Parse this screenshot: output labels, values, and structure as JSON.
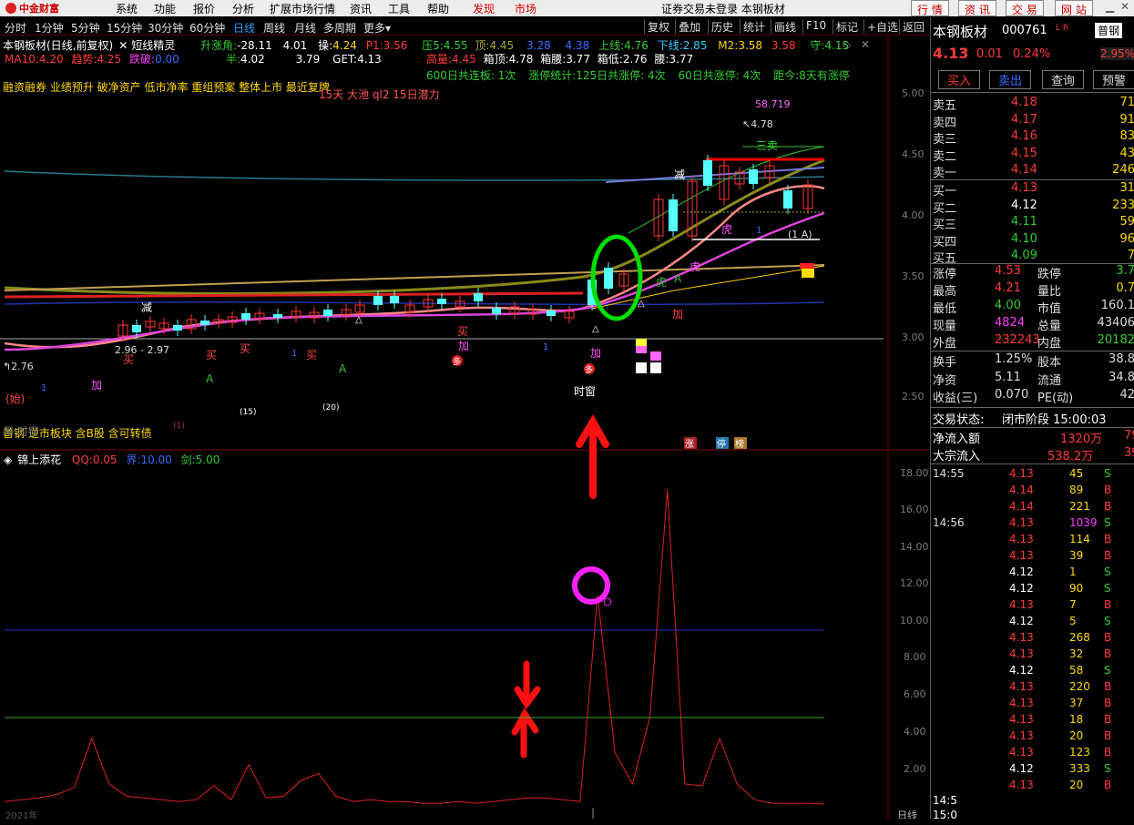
{
  "menu": {
    "items": [
      "系统",
      "功能",
      "报价",
      "分析",
      "扩展市场行情",
      "资讯",
      "工具",
      "帮助"
    ],
    "discover": "发现",
    "market": "市场",
    "center": "证券交易未登录  本钢板材",
    "right_buttons": [
      "行 情",
      "资 讯",
      "交 易",
      "网 站"
    ]
  },
  "toolbar": {
    "periods": [
      "分时",
      "1分钟",
      "5分钟",
      "15分钟",
      "30分钟",
      "60分钟",
      "日线",
      "周线",
      "月线",
      "多周期",
      "更多"
    ],
    "active": "日线",
    "right": [
      "复权",
      "叠加",
      "历史",
      "统计",
      "画线",
      "F10",
      "标记",
      "+自选",
      "返回"
    ]
  },
  "chart": {
    "title": "本钢板材(日线,前复权)",
    "formula": "短线精灵",
    "info": {
      "zhangjiao_lbl": "升涨角:",
      "zhangjiao": "-28.11",
      "v401": "4.01",
      "cao_lbl": "操:",
      "cao": "4.24",
      "p1_lbl": "P1:",
      "p1": "3.56",
      "ya5_lbl": "压5:",
      "ya5": "4.55",
      "ding_lbl": "顶:",
      "ding": "4.45",
      "v328": "3.28",
      "v438": "4.38",
      "shang_lbl": "上线:",
      "shang": "4.76",
      "xia_lbl": "下线:",
      "xia": "2.85",
      "m2_lbl": "M2:",
      "m2": "3.58",
      "m2b": "3.58",
      "shou_lbl": "守:",
      "shou": "4.15"
    },
    "info2": {
      "ban_lbl": "半:",
      "ban": "4.02",
      "get_lbl": "GET:",
      "get": "4.13",
      "v379": "3.79"
    },
    "info3": {
      "gaoliang_lbl": "高量:",
      "gaoliang": "4.45",
      "xiangding_lbl": "箱顶:",
      "xiangding": "4.78",
      "xiangyao_lbl": "箱腰:",
      "xiangyao": "3.77",
      "xiangdi_lbl": "箱低:",
      "xiangdi": "2.76",
      "yao_lbl": "腰:",
      "yao": "3.77"
    },
    "info4": {
      "lianban": "600日共连板: 1次",
      "zhangting": "涨停统计:125日共涨停: 4次",
      "zt600": "60日共涨停: 4次",
      "distance": "距今:8天有涨停"
    },
    "ma": {
      "ma10_lbl": "MA10:",
      "ma10": "4.20",
      "trend_lbl": "趋势:",
      "trend": "4.25",
      "die_lbl": "跌破:",
      "die": "0.00"
    },
    "tags": "融资融券 业绩预升 破净资产 低市净率 重组预案 整体上市 最近复牌",
    "tags2": "15天 大池 ql2 15日潜力",
    "peak": "58.719",
    "high": "4.78",
    "low_lbl": "2.76",
    "range": "2.96 - 2.97",
    "sanmai": "三卖",
    "ia": "(1 A)",
    "ylabels": [
      "5.00",
      "4.50",
      "4.00",
      "3.50",
      "3.00",
      "2.50"
    ],
    "signals": [
      "买",
      "买",
      "买",
      "买",
      "买",
      "加",
      "加",
      "加",
      "减",
      "减",
      "虎",
      "虎",
      "多",
      "多",
      "时窗",
      "(始)"
    ],
    "bottom_text": "普钢 逆市板块 含B股 含可转债",
    "bottom_text2": "用    时窗",
    "badges": [
      "涨",
      "停",
      "榜"
    ],
    "cnt": [
      "(15)",
      "(20)",
      "(1)"
    ]
  },
  "indicator": {
    "name": "锦上添花",
    "qq_lbl": "QQ:",
    "qq": "0.05",
    "jie_lbl": "界:",
    "jie": "10.00",
    "jian_lbl": "剑:",
    "jian": "5.00",
    "ylabels": [
      "18.00",
      "16.00",
      "14.00",
      "12.00",
      "10.00",
      "8.00",
      "6.00",
      "4.00",
      "2.00"
    ],
    "date": "2021年",
    "xlabel": "日线"
  },
  "chart_data": {
    "type": "line",
    "title": "锦上添花",
    "ylim": [
      0,
      19
    ],
    "series": [
      {
        "name": "QQ",
        "values": [
          0.2,
          0.3,
          0.4,
          0.6,
          1,
          3.8,
          1.2,
          0.5,
          0.4,
          0.3,
          0.2,
          0.3,
          1.1,
          0.3,
          2.3,
          0.4,
          0.5,
          1.4,
          1.8,
          0.5,
          0.2,
          0.3,
          0.2,
          0.2,
          0.1,
          0.1,
          0.2,
          0.1,
          0.2,
          0.3,
          0.4,
          0.4,
          0.3,
          0.2,
          12,
          3,
          1.2,
          5,
          18,
          1.2,
          1.1,
          3.8,
          1.2,
          0.3,
          0.1,
          0.1,
          0.1,
          0.05
        ]
      },
      {
        "name": "界",
        "values": [
          10
        ]
      },
      {
        "name": "剑",
        "values": [
          5
        ]
      }
    ]
  },
  "panel": {
    "name": "本钢板材",
    "code": "000761",
    "lr": "L R",
    "sector": "普钢",
    "price": "4.13",
    "change": "0.01",
    "pct": "0.24%",
    "pct2": "2.95%",
    "btn": [
      "买入",
      "卖出",
      "查询",
      "预警"
    ],
    "asks": [
      {
        "l": "卖五",
        "p": "4.18",
        "v": "71"
      },
      {
        "l": "卖四",
        "p": "4.17",
        "v": "91"
      },
      {
        "l": "卖三",
        "p": "4.16",
        "v": "83"
      },
      {
        "l": "卖二",
        "p": "4.15",
        "v": "43"
      },
      {
        "l": "卖一",
        "p": "4.14",
        "v": "246"
      }
    ],
    "bids": [
      {
        "l": "买一",
        "p": "4.13",
        "v": "31"
      },
      {
        "l": "买二",
        "p": "4.12",
        "v": "233"
      },
      {
        "l": "买三",
        "p": "4.11",
        "v": "59"
      },
      {
        "l": "买四",
        "p": "4.10",
        "v": "96"
      },
      {
        "l": "买五",
        "p": "4.09",
        "v": "7"
      }
    ],
    "stats": [
      {
        "a": "涨停",
        "av": "4.53",
        "b": "跌停",
        "bv": "3.7"
      },
      {
        "a": "最高",
        "av": "4.21",
        "b": "量比",
        "bv": "0.7"
      },
      {
        "a": "最低",
        "av": "4.00",
        "b": "市值",
        "bv": "160.1"
      },
      {
        "a": "现量",
        "av": "4824",
        "b": "总量",
        "bv": "43406"
      },
      {
        "a": "外盘",
        "av": "232243",
        "b": "内盘",
        "bv": "20182"
      }
    ],
    "stats2": [
      {
        "a": "换手",
        "av": "1.25%",
        "b": "股本",
        "bv": "38.8"
      },
      {
        "a": "净资",
        "av": "5.11",
        "b": "流通",
        "bv": "34.8"
      },
      {
        "a": "收益(三)",
        "av": "0.070",
        "b": "PE(动)",
        "bv": "42"
      }
    ],
    "status_lbl": "交易状态:",
    "status": "闭市阶段 15:00:03",
    "netin_lbl": "净流入额",
    "netin": "1320万",
    "netin2": "79",
    "bulk_lbl": "大宗流入",
    "bulk": "538.2万",
    "bulk2": "39",
    "ticks": [
      {
        "t": "14:55",
        "p": "4.13",
        "v": "45",
        "s": "S"
      },
      {
        "t": "",
        "p": "4.14",
        "v": "89",
        "s": "B"
      },
      {
        "t": "",
        "p": "4.14",
        "v": "221",
        "s": "B"
      },
      {
        "t": "14:56",
        "p": "4.13",
        "v": "1039",
        "s": "S"
      },
      {
        "t": "",
        "p": "4.13",
        "v": "114",
        "s": "B"
      },
      {
        "t": "",
        "p": "4.13",
        "v": "39",
        "s": "B"
      },
      {
        "t": "",
        "p": "4.12",
        "v": "1",
        "s": "S"
      },
      {
        "t": "",
        "p": "4.12",
        "v": "90",
        "s": "S"
      },
      {
        "t": "",
        "p": "4.13",
        "v": "7",
        "s": "B"
      },
      {
        "t": "",
        "p": "4.12",
        "v": "5",
        "s": "S"
      },
      {
        "t": "",
        "p": "4.13",
        "v": "268",
        "s": "B"
      },
      {
        "t": "",
        "p": "4.13",
        "v": "32",
        "s": "B"
      },
      {
        "t": "",
        "p": "4.12",
        "v": "58",
        "s": "S"
      },
      {
        "t": "",
        "p": "4.13",
        "v": "220",
        "s": "B"
      },
      {
        "t": "",
        "p": "4.13",
        "v": "37",
        "s": "B"
      },
      {
        "t": "",
        "p": "4.13",
        "v": "18",
        "s": "B"
      },
      {
        "t": "",
        "p": "4.13",
        "v": "20",
        "s": "B"
      },
      {
        "t": "",
        "p": "4.13",
        "v": "123",
        "s": "B"
      },
      {
        "t": "",
        "p": "4.12",
        "v": "333",
        "s": "S"
      },
      {
        "t": "",
        "p": "4.13",
        "v": "20",
        "s": "B"
      }
    ],
    "tick_end1": "14:5",
    "tick_end2": "15:0"
  }
}
